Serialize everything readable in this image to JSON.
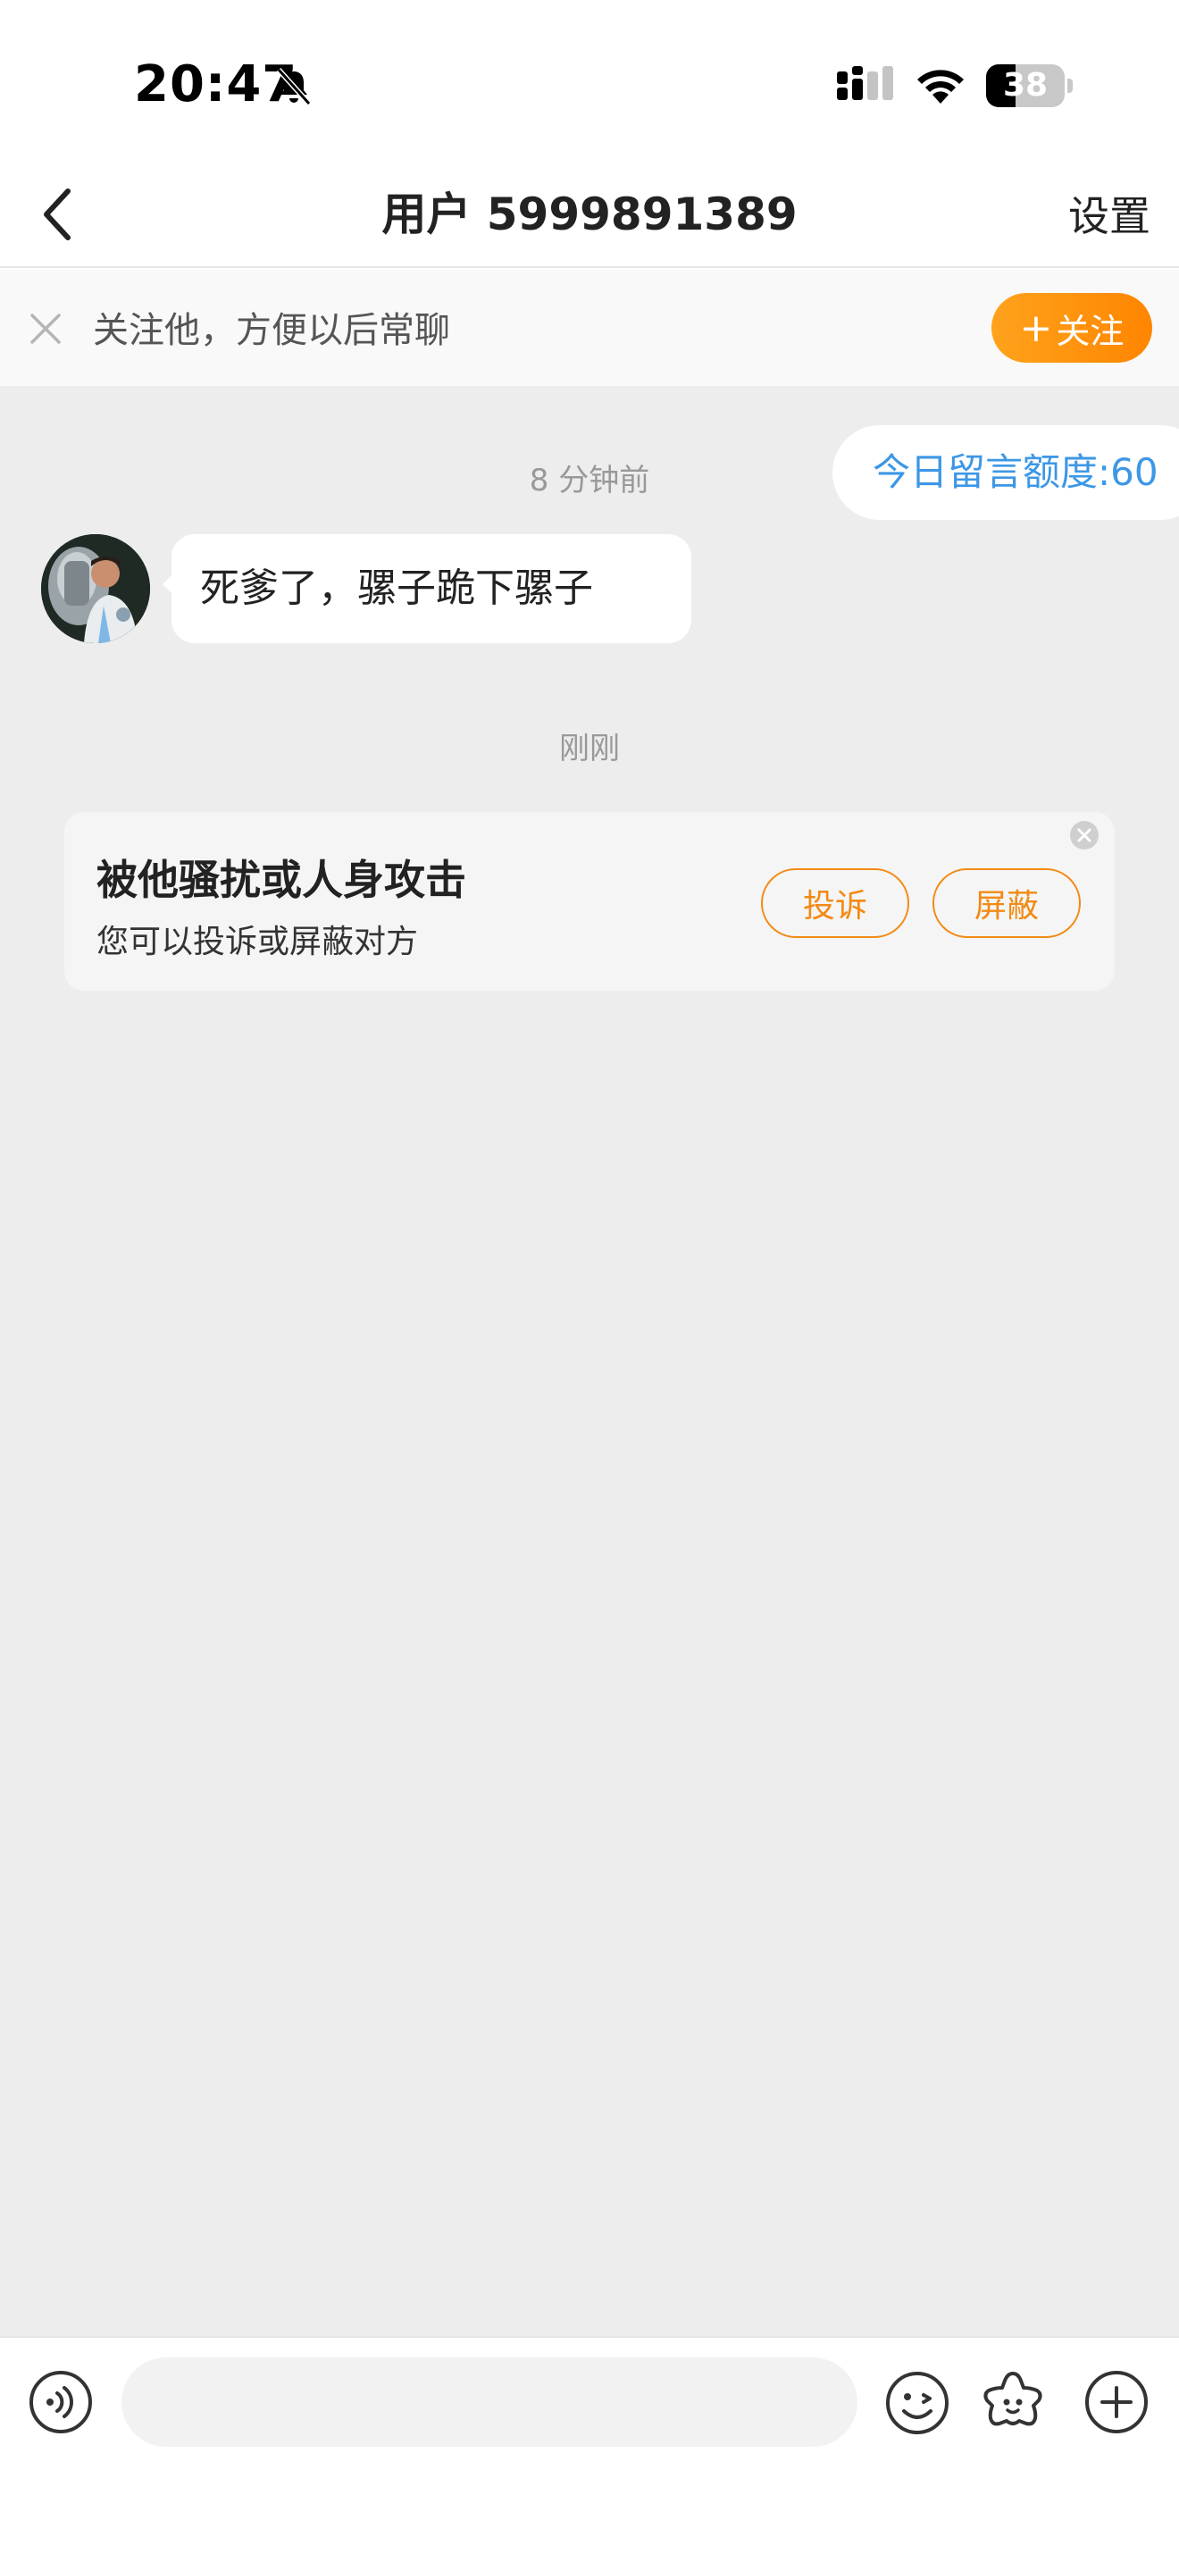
{
  "status_bar": {
    "time": "20:47",
    "battery_text": "38",
    "battery_level": 0.38
  },
  "nav": {
    "title": "用户 5999891389",
    "settings_label": "设置"
  },
  "follow_bar": {
    "text": "关注他，方便以后常聊",
    "button_label": "关注",
    "button_plus": "+"
  },
  "chat": {
    "quota_label": "今日留言额度:60",
    "messages": [
      {
        "time": "8 分钟前",
        "text": "死爹了，骡子跪下骡子"
      }
    ],
    "notice_time": "刚刚",
    "harass_card": {
      "title": "被他骚扰或人身攻击",
      "subtitle": "您可以投诉或屏蔽对方",
      "report_label": "投诉",
      "block_label": "屏蔽"
    }
  },
  "input_bar": {
    "placeholder": "",
    "value": ""
  },
  "colors": {
    "accent_orange": "#ff8a00",
    "quota_blue": "#3d97e6",
    "chat_background": "#ededed"
  }
}
